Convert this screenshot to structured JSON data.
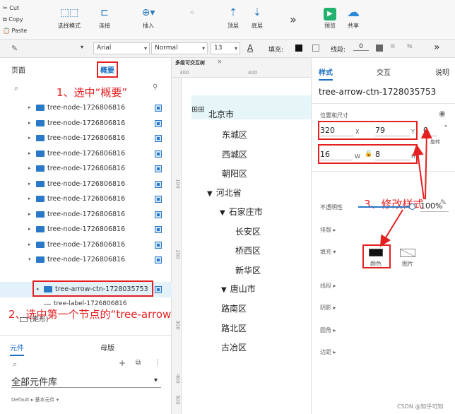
{
  "toolbar": {
    "cut": "Cut",
    "copy": "Copy",
    "paste": "Paste",
    "select_mode": "选择模式",
    "connect": "连接",
    "insert": "插入",
    "top": "顶层",
    "bottom": "底层",
    "more": "»",
    "preview": "预览",
    "share": "共享"
  },
  "format": {
    "font": "Arial",
    "style": "Normal",
    "size": "13",
    "fill_label": "填充:",
    "line_label": "线段:",
    "line_value": "0",
    "more": "»"
  },
  "left": {
    "tab_pages": "页面",
    "tab_outline": "概要",
    "tree_items": [
      "tree-node-1726806816",
      "tree-node-1726806816",
      "tree-node-1726806816",
      "tree-node-1726806816",
      "tree-node-1726806816",
      "tree-node-1726806816",
      "tree-node-1726806816",
      "tree-node-1726806816",
      "tree-node-1726806816",
      "tree-node-1726806816",
      "tree-node-1726806816"
    ],
    "selected_item": "tree-arrow-ctn-1728035753",
    "label_item": "tree-label-1726806816",
    "rect_item": "(矩形)",
    "lib_tab": "元件",
    "master_tab": "母版",
    "lib_title": "全部元件库",
    "lib_default": "Default ▸ 基本元件 ▾"
  },
  "annotations": {
    "step1": "1、选中“概要”",
    "step2": "2、选中第一个节点的“tree-arrow-ctn-1728035753”",
    "step3": "3、修改样式"
  },
  "canvas": {
    "tab": "多级可交互树",
    "ruler_300": "300",
    "ruler_400": "400",
    "v100": "100",
    "v200": "200",
    "v300": "300",
    "v400": "400",
    "v500": "500",
    "nodes": [
      "北京市",
      "东城区",
      "西城区",
      "朝阳区",
      "河北省",
      "石家庄市",
      "长安区",
      "桥西区",
      "新华区",
      "唐山市",
      "路南区",
      "路北区",
      "古冶区"
    ]
  },
  "right": {
    "tab_style": "样式",
    "tab_interact": "交互",
    "tab_notes": "说明",
    "name": "tree-arrow-ctn-1728035753",
    "pos_size": "位置和尺寸",
    "x": "320",
    "x_lbl": "X",
    "y": "79",
    "y_lbl": "Y",
    "rot": "0",
    "rot_lbl": "旋转",
    "w": "16",
    "w_lbl": "W",
    "h": "8",
    "h_lbl": "H",
    "opacity_lbl": "不透明性",
    "opacity": "100%",
    "layout": "排版",
    "fill": "填充",
    "color_lbl": "颜色",
    "image_lbl": "图片",
    "line": "线段",
    "corner": "圆角",
    "shadow": "阴影",
    "margin": "边距"
  },
  "watermark": "CSDN @知乎可知"
}
